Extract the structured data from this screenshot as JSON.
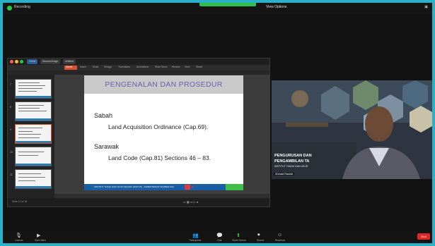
{
  "zoom": {
    "recording_label": "Recording",
    "view_options": "View Options",
    "end_label": "End"
  },
  "ppt": {
    "tabs": [
      "Home",
      "Manual Image",
      "Untitled"
    ],
    "ribbon": [
      "Home",
      "Insert",
      "Draw",
      "Design",
      "Transitions",
      "Animations",
      "Slide Show",
      "Review",
      "View",
      "Share"
    ],
    "status": "Slide 11 of 18",
    "status_icons": "▭ ▦ ▭ ▷ ●"
  },
  "slide": {
    "title": "PENGENALAN DAN PROSEDUR",
    "section1": "Sabah",
    "line1": "Land Acquisition Ordinance (Cap.69).",
    "section2": "Sarawak",
    "line2": "Land Code (Cap.81) Sections 46 – 83.",
    "footer": "INSTITUT TANAH DAN UKUR NEGARA (INSTUN) · KEMENTERIAN SUMBER ASLI"
  },
  "video": {
    "banner_line1": "PENGURUSAN DAN",
    "banner_line2": "PENGAMBILAN TA",
    "banner_line3": "INSTITUT TANAH DAN UKUR",
    "name": "Ahmad Rashid"
  },
  "toolbar": [
    {
      "icon": "mic-icon",
      "glyph": "🎙",
      "label": "Unmute"
    },
    {
      "icon": "video-icon",
      "glyph": "▶",
      "label": "Start Video"
    },
    {
      "icon": "participants-icon",
      "glyph": "👥",
      "label": "Participants"
    },
    {
      "icon": "chat-icon",
      "glyph": "💬",
      "label": "Chat"
    },
    {
      "icon": "share-icon",
      "glyph": "⬆",
      "label": "Share Screen"
    },
    {
      "icon": "record-icon",
      "glyph": "⏺",
      "label": "Record"
    },
    {
      "icon": "reactions-icon",
      "glyph": "☺",
      "label": "Reactions"
    }
  ],
  "colors": {
    "accent": "#d9512c",
    "slide_title": "#6a5fb0",
    "share_bar": "#2fbf4f",
    "end_button": "#e02828"
  }
}
